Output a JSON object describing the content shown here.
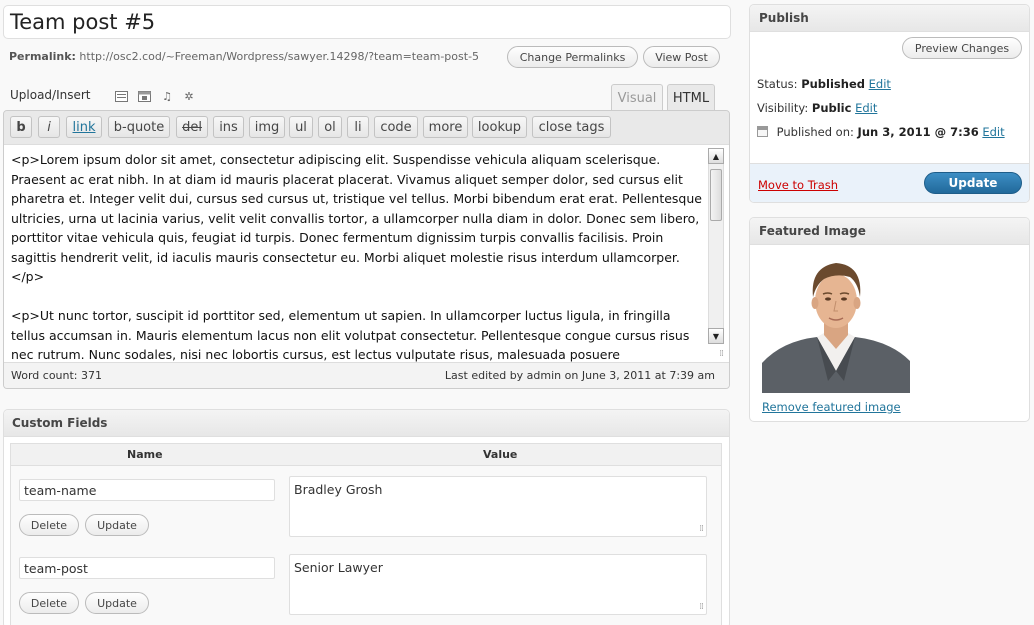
{
  "post": {
    "title": "Team post #5",
    "permalink_label": "Permalink:",
    "permalink_url": "http://osc2.cod/~Freeman/Wordpress/sawyer.14298/?team=team-post-5",
    "change_permalinks": "Change Permalinks",
    "view_post": "View Post"
  },
  "editor": {
    "upload_label": "Upload/Insert",
    "media_icons": [
      "image-icon",
      "video-icon",
      "audio-icon",
      "media-icon"
    ],
    "tabs": {
      "visual": "Visual",
      "html": "HTML"
    },
    "quicktags": [
      "b",
      "i",
      "link",
      "b-quote",
      "del",
      "ins",
      "img",
      "ul",
      "ol",
      "li",
      "code",
      "more",
      "lookup",
      "close tags"
    ],
    "content": "<p>Lorem ipsum dolor sit amet, consectetur adipiscing elit. Suspendisse vehicula aliquam scelerisque. Praesent ac erat nibh. In at diam id mauris placerat placerat. Vivamus aliquet semper dolor, sed cursus elit pharetra et. Integer velit dui, cursus sed cursus ut, tristique vel tellus. Morbi bibendum erat erat. Pellentesque ultricies, urna ut lacinia varius, velit velit convallis tortor, a ullamcorper nulla diam in dolor. Donec sem libero, porttitor vitae vehicula quis, feugiat id turpis. Donec fermentum dignissim turpis convallis facilisis. Proin sagittis hendrerit velit, id iaculis mauris consectetur eu. Morbi aliquet molestie risus interdum ullamcorper.</p>\n\n<p>Ut nunc tortor, suscipit id porttitor sed, elementum ut sapien. In ullamcorper luctus ligula, in fringilla tellus accumsan in. Mauris elementum lacus non elit volutpat consectetur. Pellentesque congue cursus risus nec rutrum. Nunc sodales, nisi nec lobortis cursus, est lectus vulputate risus, malesuada posuere",
    "word_count": "Word count: 371",
    "last_edited": "Last edited by admin on June 3, 2011 at 7:39 am"
  },
  "custom_fields": {
    "title": "Custom Fields",
    "col_name": "Name",
    "col_value": "Value",
    "rows": [
      {
        "name": "team-name",
        "value": "Bradley Grosh",
        "delete": "Delete",
        "update": "Update"
      },
      {
        "name": "team-post",
        "value": "Senior Lawyer",
        "delete": "Delete",
        "update": "Update"
      }
    ]
  },
  "publish": {
    "title": "Publish",
    "preview": "Preview Changes",
    "status_label": "Status:",
    "status_value": "Published",
    "visibility_label": "Visibility:",
    "visibility_value": "Public",
    "published_label": "Published on:",
    "published_value": "Jun 3, 2011 @ 7:36",
    "edit": "Edit",
    "trash": "Move to Trash",
    "update": "Update"
  },
  "featured": {
    "title": "Featured Image",
    "remove": "Remove featured image"
  },
  "colors": {
    "link": "#21759b",
    "primary_button": "#21699b",
    "trash": "#cc0000"
  }
}
